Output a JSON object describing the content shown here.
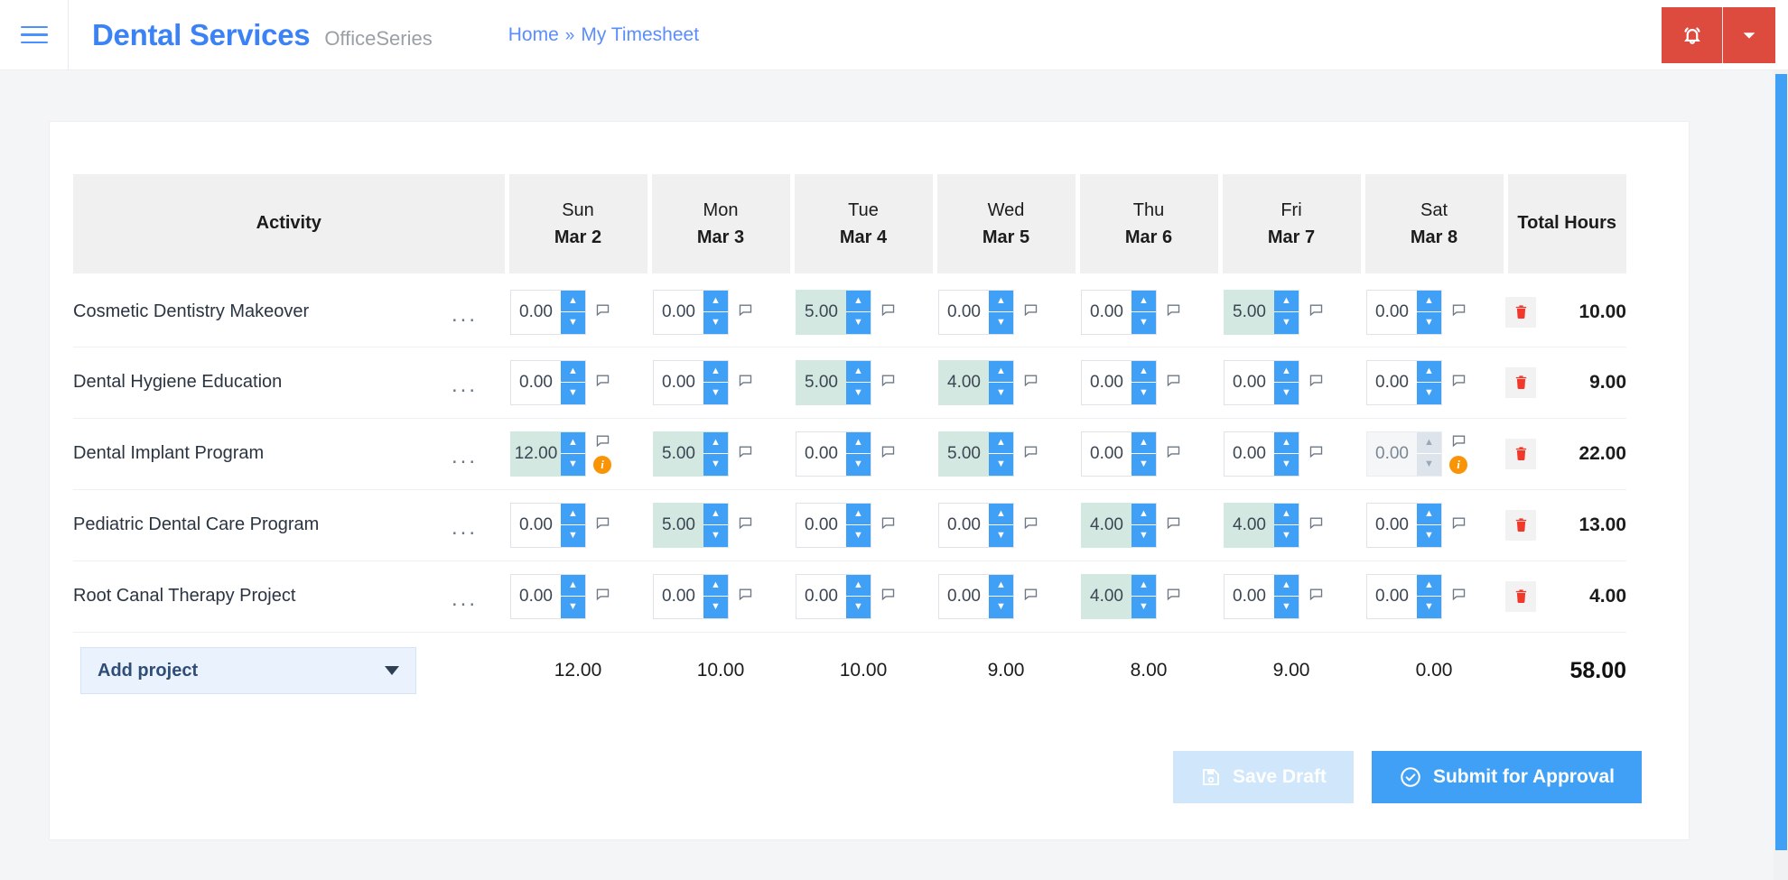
{
  "header": {
    "menu_icon": "hamburger-icon",
    "brand_title": "Dental Services",
    "brand_subtitle": "OfficeSeries",
    "breadcrumb": {
      "home": "Home",
      "separator": "»",
      "current": "My Timesheet"
    },
    "notification_icon": "bell-icon",
    "dropdown_icon": "chevron-down-icon",
    "accent_red": "#dd4b3e",
    "accent_blue": "#3b82f6"
  },
  "table": {
    "activity_header": "Activity",
    "total_header": "Total Hours",
    "days": [
      {
        "dow": "Sun",
        "date": "Mar 2"
      },
      {
        "dow": "Mon",
        "date": "Mar 3"
      },
      {
        "dow": "Tue",
        "date": "Mar 4"
      },
      {
        "dow": "Wed",
        "date": "Mar 5"
      },
      {
        "dow": "Thu",
        "date": "Mar 6"
      },
      {
        "dow": "Fri",
        "date": "Mar 7"
      },
      {
        "dow": "Sat",
        "date": "Mar 8"
      }
    ],
    "rows": [
      {
        "activity": "Cosmetic Dentistry Makeover",
        "menu": "...",
        "cells": [
          {
            "value": "0.00",
            "filled": false,
            "disabled": false,
            "info": false
          },
          {
            "value": "0.00",
            "filled": false,
            "disabled": false,
            "info": false
          },
          {
            "value": "5.00",
            "filled": true,
            "disabled": false,
            "info": false
          },
          {
            "value": "0.00",
            "filled": false,
            "disabled": false,
            "info": false
          },
          {
            "value": "0.00",
            "filled": false,
            "disabled": false,
            "info": false
          },
          {
            "value": "5.00",
            "filled": true,
            "disabled": false,
            "info": false
          },
          {
            "value": "0.00",
            "filled": false,
            "disabled": false,
            "info": false
          }
        ],
        "total": "10.00"
      },
      {
        "activity": "Dental Hygiene Education",
        "menu": "...",
        "cells": [
          {
            "value": "0.00",
            "filled": false,
            "disabled": false,
            "info": false
          },
          {
            "value": "0.00",
            "filled": false,
            "disabled": false,
            "info": false
          },
          {
            "value": "5.00",
            "filled": true,
            "disabled": false,
            "info": false
          },
          {
            "value": "4.00",
            "filled": true,
            "disabled": false,
            "info": false
          },
          {
            "value": "0.00",
            "filled": false,
            "disabled": false,
            "info": false
          },
          {
            "value": "0.00",
            "filled": false,
            "disabled": false,
            "info": false
          },
          {
            "value": "0.00",
            "filled": false,
            "disabled": false,
            "info": false
          }
        ],
        "total": "9.00"
      },
      {
        "activity": "Dental Implant Program",
        "menu": "...",
        "cells": [
          {
            "value": "12.00",
            "filled": true,
            "disabled": false,
            "info": true
          },
          {
            "value": "5.00",
            "filled": true,
            "disabled": false,
            "info": false
          },
          {
            "value": "0.00",
            "filled": false,
            "disabled": false,
            "info": false
          },
          {
            "value": "5.00",
            "filled": true,
            "disabled": false,
            "info": false
          },
          {
            "value": "0.00",
            "filled": false,
            "disabled": false,
            "info": false
          },
          {
            "value": "0.00",
            "filled": false,
            "disabled": false,
            "info": false
          },
          {
            "value": "0.00",
            "filled": false,
            "disabled": true,
            "info": true
          }
        ],
        "total": "22.00"
      },
      {
        "activity": "Pediatric Dental Care Program",
        "menu": "...",
        "cells": [
          {
            "value": "0.00",
            "filled": false,
            "disabled": false,
            "info": false
          },
          {
            "value": "5.00",
            "filled": true,
            "disabled": false,
            "info": false
          },
          {
            "value": "0.00",
            "filled": false,
            "disabled": false,
            "info": false
          },
          {
            "value": "0.00",
            "filled": false,
            "disabled": false,
            "info": false
          },
          {
            "value": "4.00",
            "filled": true,
            "disabled": false,
            "info": false
          },
          {
            "value": "4.00",
            "filled": true,
            "disabled": false,
            "info": false
          },
          {
            "value": "0.00",
            "filled": false,
            "disabled": false,
            "info": false
          }
        ],
        "total": "13.00"
      },
      {
        "activity": "Root Canal Therapy Project",
        "menu": "...",
        "cells": [
          {
            "value": "0.00",
            "filled": false,
            "disabled": false,
            "info": false
          },
          {
            "value": "0.00",
            "filled": false,
            "disabled": false,
            "info": false
          },
          {
            "value": "0.00",
            "filled": false,
            "disabled": false,
            "info": false
          },
          {
            "value": "0.00",
            "filled": false,
            "disabled": false,
            "info": false
          },
          {
            "value": "4.00",
            "filled": true,
            "disabled": false,
            "info": false
          },
          {
            "value": "0.00",
            "filled": false,
            "disabled": false,
            "info": false
          },
          {
            "value": "0.00",
            "filled": false,
            "disabled": false,
            "info": false
          }
        ],
        "total": "4.00"
      }
    ],
    "add_project_label": "Add project",
    "column_totals": [
      "12.00",
      "10.00",
      "10.00",
      "9.00",
      "8.00",
      "9.00",
      "0.00"
    ],
    "grand_total": "58.00",
    "delete_icon": "trash-icon",
    "note_icon": "comment-icon",
    "info_icon": "info-badge-icon",
    "spinner_up_icon": "chevron-up-icon",
    "spinner_down_icon": "chevron-down-icon",
    "filled_cell_color": "#d3e8e1",
    "spinner_color": "#3fa0f5",
    "info_color": "#f89406",
    "delete_color": "#f1392b"
  },
  "actions": {
    "save_draft_label": "Save Draft",
    "save_draft_icon": "save-disk-icon",
    "submit_label": "Submit for Approval",
    "submit_icon": "check-circle-icon"
  }
}
